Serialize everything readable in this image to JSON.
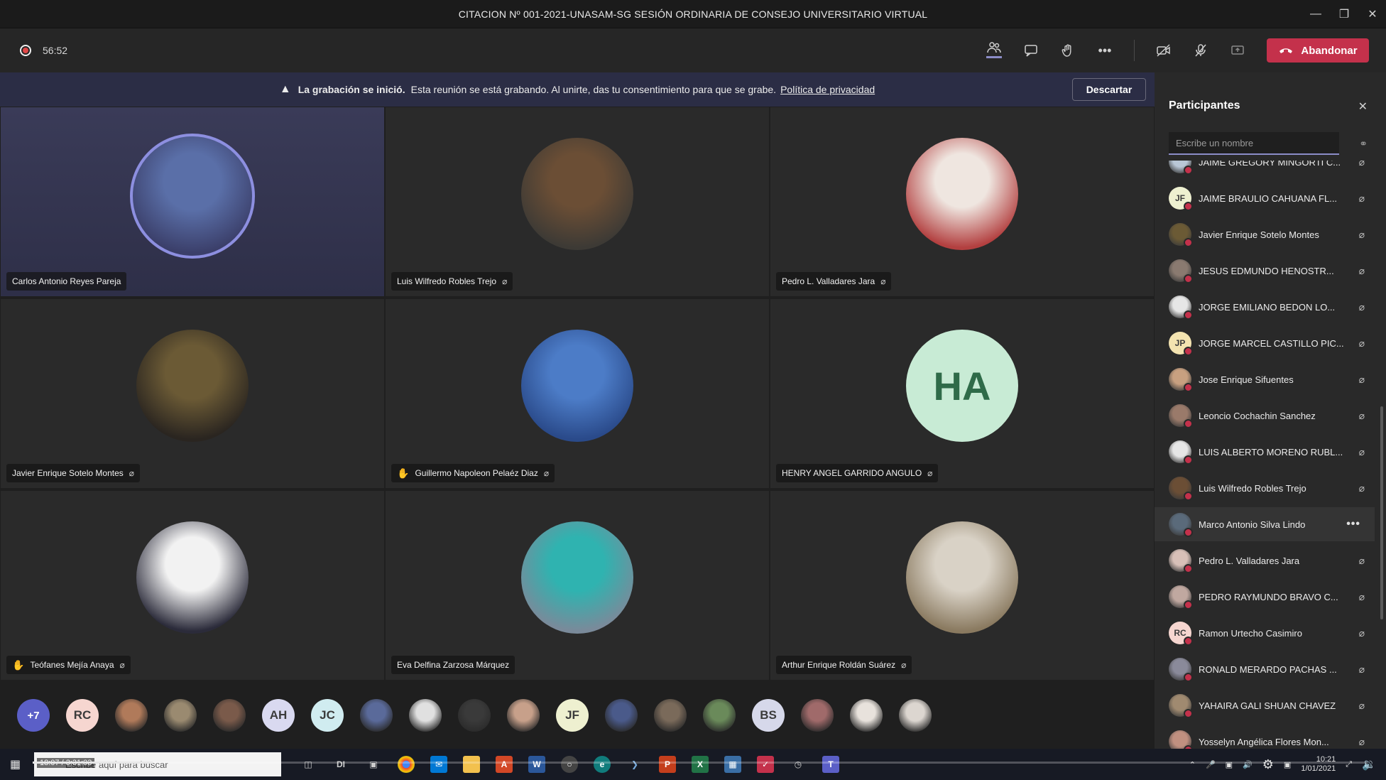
{
  "window": {
    "title": "CITACION Nº 001-2021-UNASAM-SG SESIÓN ORDINARIA DE CONSEJO UNIVERSITARIO VIRTUAL"
  },
  "toolbar": {
    "timer": "56:52",
    "leave_label": "Abandonar"
  },
  "banner": {
    "bold_text": "La grabación se inició.",
    "text": "Esta reunión se está grabando. Al unirte, das tu consentimiento para que se grabe.",
    "link_text": "Política de privacidad",
    "dismiss_label": "Descartar"
  },
  "tiles": [
    {
      "name": "Carlos Antonio Reyes Pareja",
      "speaking": true,
      "muted": false,
      "hand": false,
      "photo": [
        "#5a6fa8",
        "#3b3f6a"
      ]
    },
    {
      "name": "Luis Wilfredo Robles Trejo",
      "muted": true,
      "hand": false,
      "photo": [
        "#6b4e35",
        "#3d3a35"
      ]
    },
    {
      "name": "Pedro L. Valladares Jara",
      "muted": true,
      "hand": false,
      "photo": [
        "#efe6e0",
        "#b34040"
      ]
    },
    {
      "name": "Javier Enrique Sotelo Montes",
      "muted": true,
      "hand": false,
      "photo": [
        "#6b5a35",
        "#2a2520"
      ]
    },
    {
      "name": "Guillermo Napoleon Pelaéz Diaz",
      "muted": true,
      "hand": true,
      "photo": [
        "#4c7cc7",
        "#2a4a8a"
      ]
    },
    {
      "name": "HENRY ANGEL GARRIDO ANGULO",
      "muted": true,
      "hand": false,
      "initials": "HA",
      "bg": "#c8ebd5",
      "fg": "#2f6b49"
    },
    {
      "name": "Teófanes Mejía Anaya",
      "muted": true,
      "hand": true,
      "photo": [
        "#f2f2f2",
        "#2b2b3a"
      ]
    },
    {
      "name": "Eva Delfina Zarzosa Márquez",
      "muted": false,
      "hand": false,
      "photo": [
        "#2fb3b0",
        "#7a8a9a"
      ]
    },
    {
      "name": "Arthur Enrique Roldán Suárez",
      "muted": true,
      "hand": false,
      "photo": [
        "#d9d2c6",
        "#8a7a60"
      ]
    }
  ],
  "strip": {
    "more_label": "+7",
    "items": [
      {
        "initials": "RC",
        "bg": "#f6d6d0"
      },
      {
        "photo": "#b07a5a"
      },
      {
        "photo": "#9a8a70"
      },
      {
        "photo": "#7a5a4a"
      },
      {
        "initials": "AH",
        "bg": "#d9d9f0"
      },
      {
        "initials": "JC",
        "bg": "#d0ecf0"
      },
      {
        "photo": "#5a6a9a"
      },
      {
        "photo": "#e0e0e0"
      },
      {
        "photo": "#3a3a3a"
      },
      {
        "photo": "#c7a08a"
      },
      {
        "initials": "JF",
        "bg": "#eef0d0"
      },
      {
        "photo": "#4a5a8a"
      },
      {
        "photo": "#7a6a5a"
      },
      {
        "photo": "#6a8a5a"
      },
      {
        "initials": "BS",
        "bg": "#d6d8ea"
      },
      {
        "photo": "#a06a6a"
      },
      {
        "photo": "#e8e2dc"
      },
      {
        "photo": "#dcd6d0"
      }
    ]
  },
  "panel": {
    "title": "Participantes",
    "search_placeholder": "Escribe un nombre",
    "participants": [
      {
        "name": "JAIME GREGORY MINGORTI C...",
        "color": "#b9c7d6"
      },
      {
        "name": "JAIME BRAULIO CAHUANA FL...",
        "initials": "JF",
        "color": "#eef0d0"
      },
      {
        "name": "Javier Enrique Sotelo Montes",
        "color": "#6b5a35"
      },
      {
        "name": "JESUS EDMUNDO HENOSTR...",
        "color": "#8a7a70"
      },
      {
        "name": "JORGE EMILIANO BEDON LO...",
        "color": "#e6e6e6"
      },
      {
        "name": "JORGE MARCEL CASTILLO PIC...",
        "initials": "JP",
        "color": "#f3e3b0"
      },
      {
        "name": "Jose Enrique Sifuentes",
        "color": "#c8a080"
      },
      {
        "name": "Leoncio Cochachin Sanchez",
        "color": "#9a7a6a"
      },
      {
        "name": "LUIS ALBERTO MORENO RUBL...",
        "color": "#e6e6e6"
      },
      {
        "name": "Luis Wilfredo Robles Trejo",
        "color": "#6b4e35"
      },
      {
        "name": "Marco Antonio Silva Lindo",
        "color": "#5a6a7a",
        "hover": true
      },
      {
        "name": "Pedro L. Valladares Jara",
        "color": "#d8c0b8"
      },
      {
        "name": "PEDRO RAYMUNDO BRAVO C...",
        "color": "#c0a8a0"
      },
      {
        "name": "Ramon Urtecho Casimiro",
        "initials": "RC",
        "color": "#f6d6d0"
      },
      {
        "name": "RONALD MERARDO PACHAS ...",
        "color": "#8a8a9a"
      },
      {
        "name": "YAHAIRA GALI SHUAN CHAVEZ",
        "color": "#a08a70"
      },
      {
        "name": "Yosselyn Angélica Flores Mon...",
        "color": "#c09080"
      }
    ]
  },
  "taskbar": {
    "search_placeholder": "Escribe aquí para buscar",
    "video_time": "18:07 / 3:31:03",
    "clock_time": "10:21",
    "clock_date": "1/01/2021",
    "video_progress": 0.09
  }
}
